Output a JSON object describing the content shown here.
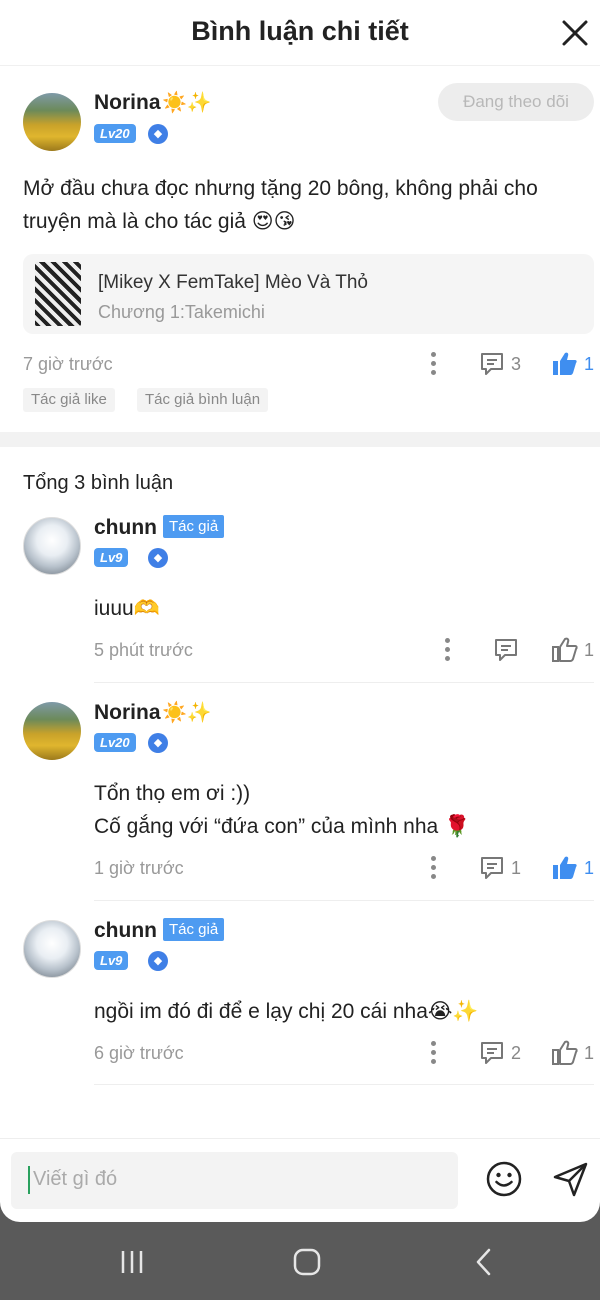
{
  "header": {
    "title": "Bình luận chi tiết",
    "close_icon": "close-icon"
  },
  "main_comment": {
    "author": "Norina",
    "author_deco": "☀️✨",
    "level": "Lv20",
    "follow_label": "Đang theo dõi",
    "text_line1": "Mở đầu chưa đọc nhưng tặng 20 bông, không phải cho",
    "text_line2": "truyện mà là cho tác giả 😍😘",
    "story_title": "[Mikey X FemTake] Mèo Và Thỏ",
    "story_chapter": "Chương 1:Takemichi",
    "time": "7 giờ trước",
    "reply_count": "3",
    "like_count": "1",
    "liked": true,
    "tags": [
      "Tác giả like",
      "Tác giả bình luận"
    ]
  },
  "replies_header": "Tổng 3 bình luận",
  "author_badge": "Tác giả",
  "replies": [
    {
      "author": "chunn",
      "level": "Lv9",
      "is_author": true,
      "text": "iuuu🫶",
      "time": "5 phút trước",
      "like_count": "1",
      "liked": false
    },
    {
      "author": "Norina",
      "author_deco": "☀️✨",
      "level": "Lv20",
      "is_author": false,
      "text_line1": "Tổn thọ em ơi :))",
      "text_line2": "Cố gắng với “đứa con” của mình nha 🌹",
      "time": "1 giờ trước",
      "reply_count": "1",
      "like_count": "1",
      "liked": true
    },
    {
      "author": "chunn",
      "level": "Lv9",
      "is_author": true,
      "text": "ngồi im đó đi để e lạy chị 20 cái nha😭✨",
      "time": "6 giờ trước",
      "reply_count": "2",
      "like_count": "1",
      "liked": false
    }
  ],
  "composer": {
    "placeholder": "Viết gì đó"
  },
  "colors": {
    "accent": "#4e9bf1",
    "like_active": "#3f8ef0",
    "muted": "#999999"
  }
}
